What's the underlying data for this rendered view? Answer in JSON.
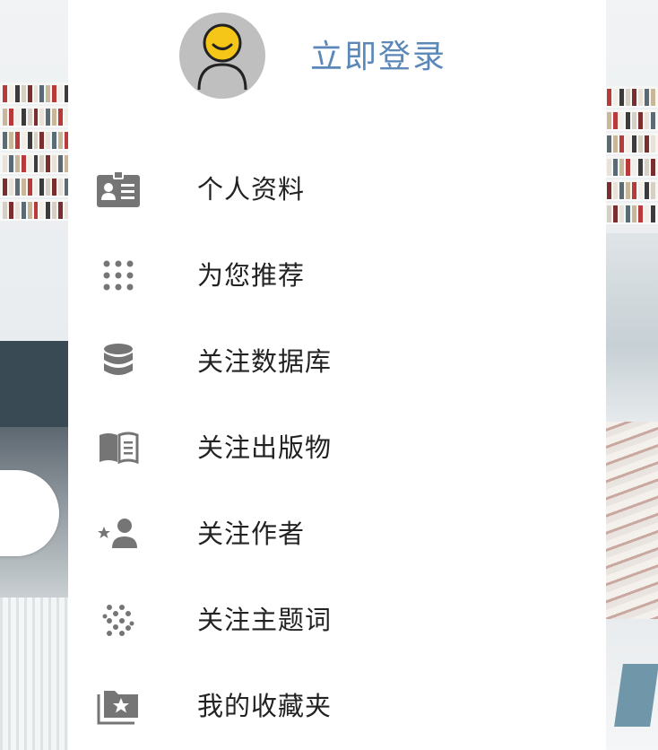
{
  "header": {
    "avatar_icon": "user-avatar-icon",
    "login_label": "立即登录"
  },
  "menu": {
    "items": [
      {
        "label": "个人资料",
        "icon": "id-card-icon"
      },
      {
        "label": "为您推荐",
        "icon": "dots-grid-icon"
      },
      {
        "label": "关注数据库",
        "icon": "database-icon"
      },
      {
        "label": "关注出版物",
        "icon": "book-open-icon"
      },
      {
        "label": "关注作者",
        "icon": "star-person-icon"
      },
      {
        "label": "关注主题词",
        "icon": "scatter-dots-icon"
      },
      {
        "label": "我的收藏夹",
        "icon": "star-folder-icon"
      }
    ]
  },
  "colors": {
    "accent": "#5b88b8",
    "icon_gray": "#757575",
    "avatar_bg": "#bfbfbf",
    "avatar_face": "#f5c518",
    "text": "#222222"
  }
}
